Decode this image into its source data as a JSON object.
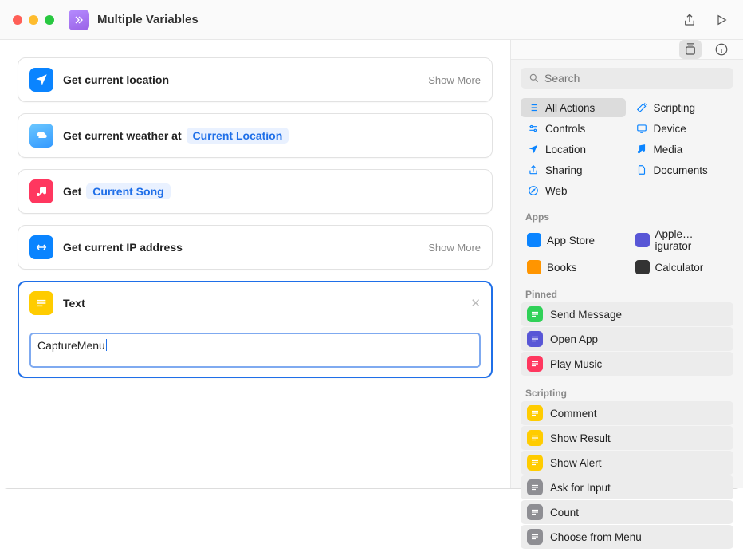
{
  "window": {
    "title": "Multiple Variables"
  },
  "toolbar": {
    "share": "share-icon",
    "run": "play-icon"
  },
  "actions": [
    {
      "kind": "simple",
      "icon": "location",
      "iconBg": "#0a84ff",
      "title": "Get current location",
      "showMore": "Show More"
    },
    {
      "kind": "token",
      "icon": "weather",
      "iconBg": "#59bdf7",
      "titlePrefix": "Get current weather at",
      "token": "Current Location"
    },
    {
      "kind": "token",
      "icon": "music",
      "iconBg": "#ff375f",
      "titlePrefix": "Get",
      "token": "Current Song"
    },
    {
      "kind": "simple",
      "icon": "network",
      "iconBg": "#0a84ff",
      "title": "Get current IP address",
      "showMore": "Show More"
    },
    {
      "kind": "text",
      "icon": "text",
      "iconBg": "#ffcc00",
      "title": "Text",
      "value": "CaptureMenu",
      "selected": true
    }
  ],
  "sidebar": {
    "searchPlaceholder": "Search",
    "categories": [
      {
        "label": "All Actions",
        "icon": "list",
        "color": "#0a84ff",
        "selected": true
      },
      {
        "label": "Scripting",
        "icon": "wand",
        "color": "#0a84ff"
      },
      {
        "label": "Controls",
        "icon": "slider",
        "color": "#0a84ff"
      },
      {
        "label": "Device",
        "icon": "display",
        "color": "#0a84ff"
      },
      {
        "label": "Location",
        "icon": "nav",
        "color": "#0a84ff"
      },
      {
        "label": "Media",
        "icon": "note",
        "color": "#0a84ff"
      },
      {
        "label": "Sharing",
        "icon": "share",
        "color": "#0a84ff"
      },
      {
        "label": "Documents",
        "icon": "doc",
        "color": "#0a84ff"
      },
      {
        "label": "Web",
        "icon": "safari",
        "color": "#0a84ff"
      }
    ],
    "sections": [
      {
        "header": "Apps",
        "rows": [
          {
            "label": "App Store",
            "iconBg": "#0a84ff"
          },
          {
            "label": "Apple…igurator",
            "iconBg": "#5856d6"
          },
          {
            "label": "Books",
            "iconBg": "#ff9500",
            "half": true
          },
          {
            "label": "Calculator",
            "iconBg": "#333",
            "half": true
          }
        ],
        "grid": true
      },
      {
        "header": "Pinned",
        "rows": [
          {
            "label": "Send Message",
            "iconBg": "#30d158"
          },
          {
            "label": "Open App",
            "iconBg": "#5856d6"
          },
          {
            "label": "Play Music",
            "iconBg": "#ff375f"
          }
        ]
      },
      {
        "header": "Scripting",
        "rows": [
          {
            "label": "Comment",
            "iconBg": "#ffcc00"
          },
          {
            "label": "Show Result",
            "iconBg": "#ffcc00"
          },
          {
            "label": "Show Alert",
            "iconBg": "#ffcc00"
          },
          {
            "label": "Ask for Input",
            "iconBg": "#8e8e93"
          },
          {
            "label": "Count",
            "iconBg": "#8e8e93"
          },
          {
            "label": "Choose from Menu",
            "iconBg": "#8e8e93"
          }
        ]
      }
    ]
  }
}
